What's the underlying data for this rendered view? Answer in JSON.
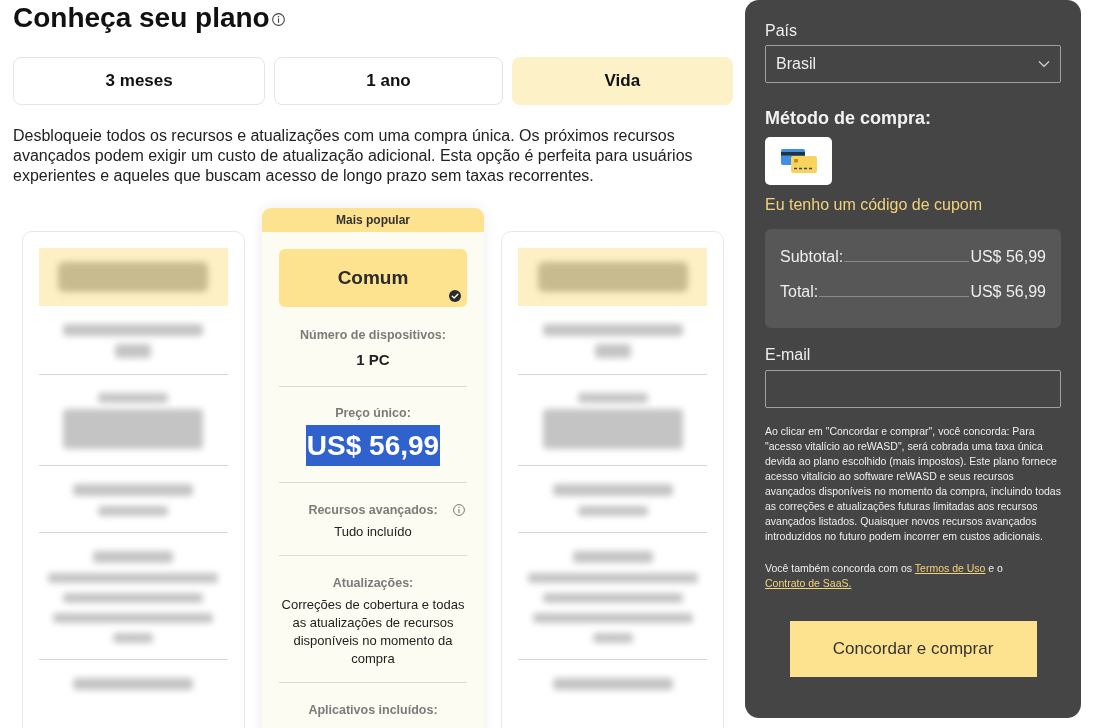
{
  "page": {
    "title": "Conheça seu plano"
  },
  "billing_tabs": [
    {
      "label": "3 meses",
      "selected": false
    },
    {
      "label": "1 ano",
      "selected": false
    },
    {
      "label": "Vida",
      "selected": true
    }
  ],
  "description": "Desbloqueie todos os recursos e atualizações com uma compra única. Os próximos recursos avançados podem exigir um custo de atualização adicional. Esta opção é perfeita para usuários experientes e aqueles que buscam acesso de longo prazo sem taxas recorrentes.",
  "plans": [
    {
      "kind": "blurred",
      "selected": false
    },
    {
      "kind": "detailed",
      "selected": true,
      "ribbon": "Mais popular",
      "name": "Comum",
      "features": [
        {
          "kind": "plain",
          "label": "Número de dispositivos:",
          "value": "1 PC"
        },
        {
          "kind": "price",
          "label": "Preço único:",
          "value": "US$ 56,99",
          "text_selected": true
        },
        {
          "kind": "info",
          "label": "Recursos avançados:",
          "value": "Tudo incluído"
        },
        {
          "kind": "text",
          "label": "Atualizações:",
          "value": "Correções de cobertura e todas as atualizações de recursos disponíveis no momento da compra"
        },
        {
          "kind": "text",
          "label": "Aplicativos incluídos:"
        }
      ]
    },
    {
      "kind": "blurred",
      "selected": false
    }
  ],
  "checkout": {
    "country_label": "País",
    "country": "Brasil",
    "payment_heading": "Método de compra:",
    "coupon_link": "Eu tenho um código de cupom",
    "summary": [
      {
        "label": "Subtotal:",
        "value": "US$ 56,99"
      },
      {
        "label": "Total:",
        "value": "US$ 56,99"
      }
    ],
    "email_label": "E-mail",
    "legal_text": "Ao clicar em \"Concordar e comprar\", você concorda: Para \"acesso vitalício ao reWASD\", será cobrada uma taxa única devida ao plano escolhido (mais impostos). Este plano fornece acesso vitalício ao software reWASD e seus recursos avançados disponíveis no momento da compra, incluindo todas as correções e atualizações futuras limitadas aos recursos avançados listados. Quaisquer novos recursos avançados introduzidos no futuro podem incorrer em custos adicionais.",
    "agreement": [
      {
        "kind": "text",
        "text": "Você também concorda com os"
      },
      {
        "kind": "link",
        "text": "Termos de Uso"
      },
      {
        "kind": "text",
        "text": "e o"
      },
      {
        "kind": "link",
        "text": "Contrato de SaaS."
      }
    ],
    "submit_button": "Concordar e comprar"
  }
}
